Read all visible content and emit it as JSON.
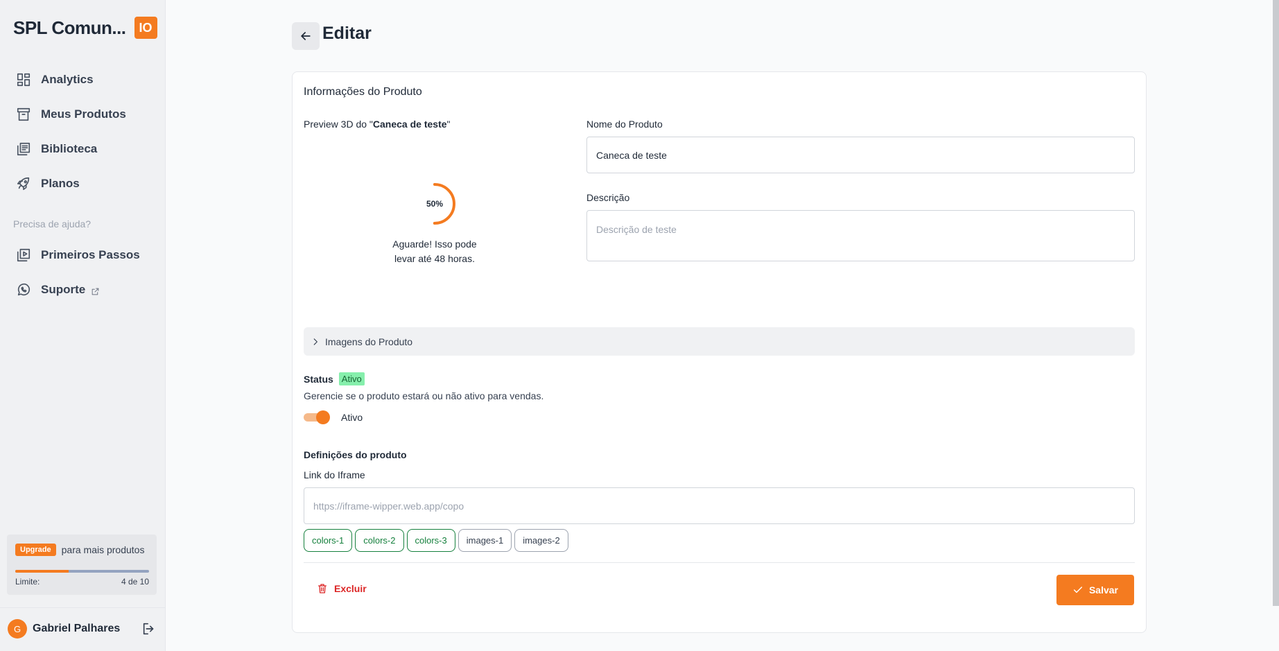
{
  "sidebar": {
    "brand": "SPL Comun...",
    "brand_badge": "IO",
    "items": [
      {
        "label": "Analytics",
        "icon": "dashboard-icon"
      },
      {
        "label": "Meus Produtos",
        "icon": "archive-icon"
      },
      {
        "label": "Biblioteca",
        "icon": "library-icon"
      },
      {
        "label": "Planos",
        "icon": "rocket-icon"
      }
    ],
    "help_label": "Precisa de ajuda?",
    "help_items": [
      {
        "label": "Primeiros Passos",
        "icon": "video-library-icon"
      },
      {
        "label": "Suporte",
        "icon": "whatsapp-icon"
      }
    ],
    "plan": {
      "upgrade_label": "Upgrade",
      "upgrade_text": "para mais produtos",
      "limit_label": "Limite:",
      "limit_value": "4 de 10",
      "limit_fraction": 0.4
    },
    "user": {
      "initial": "G",
      "name": "Gabriel Palhares"
    }
  },
  "header": {
    "title": "Editar"
  },
  "card": {
    "title": "Informações do Produto",
    "preview_prefix": "Preview 3D do \"",
    "preview_product": "Caneca de teste",
    "preview_suffix": "\"",
    "progress_text": "50%",
    "progress_value": 0.5,
    "wait_line1": "Aguarde! Isso pode",
    "wait_line2": "levar até 48 horas.",
    "name_label": "Nome do Produto",
    "name_value": "Caneca de teste",
    "desc_label": "Descrição",
    "desc_placeholder": "Descrição de teste",
    "images_label": "Imagens do Produto",
    "status_label": "Status",
    "status_badge": "Ativo",
    "status_desc": "Gerencie se o produto estará ou não ativo para vendas.",
    "toggle_label": "Ativo",
    "definitions_title": "Definições do produto",
    "iframe_label": "Link do Iframe",
    "iframe_placeholder": "https://iframe-wipper.web.app/copo",
    "chips": [
      {
        "label": "colors-1",
        "style": "green"
      },
      {
        "label": "colors-2",
        "style": "green"
      },
      {
        "label": "colors-3",
        "style": "green"
      },
      {
        "label": "images-1",
        "style": "gray"
      },
      {
        "label": "images-2",
        "style": "gray"
      }
    ],
    "delete_label": "Excluir",
    "save_label": "Salvar"
  },
  "colors": {
    "accent": "#f47b20",
    "danger": "#dc2626",
    "success": "#15803d"
  }
}
